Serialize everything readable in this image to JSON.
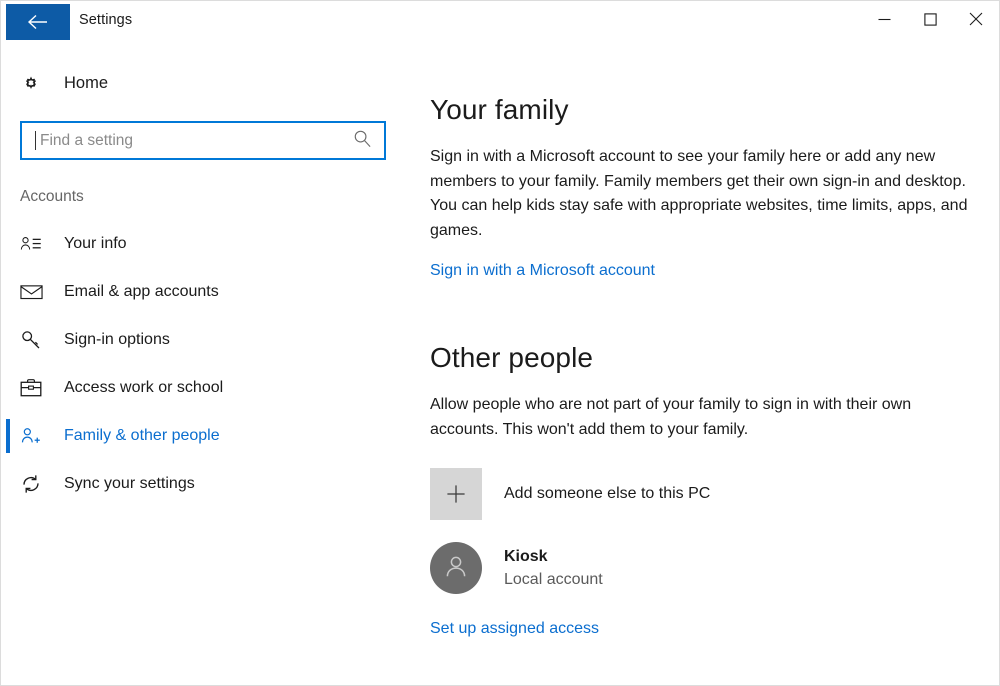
{
  "window": {
    "title": "Settings",
    "back_icon": "back-arrow-icon",
    "minimize_icon": "minimize-icon",
    "maximize_icon": "maximize-icon",
    "close_icon": "close-icon",
    "accent_color": "#0078d7",
    "link_color": "#0b6ecf",
    "titlebar_button_color": "#0d5ba6"
  },
  "sidebar": {
    "home": {
      "label": "Home",
      "icon": "gear-icon"
    },
    "search": {
      "placeholder": "Find a setting",
      "value": "",
      "icon": "search-icon",
      "focused": true
    },
    "section_label": "Accounts",
    "items": [
      {
        "label": "Your info",
        "icon": "person-info-icon",
        "selected": false
      },
      {
        "label": "Email & app accounts",
        "icon": "envelope-icon",
        "selected": false
      },
      {
        "label": "Sign-in options",
        "icon": "key-icon",
        "selected": false
      },
      {
        "label": "Access work or school",
        "icon": "briefcase-icon",
        "selected": false
      },
      {
        "label": "Family & other people",
        "icon": "person-add-icon",
        "selected": true
      },
      {
        "label": "Sync your settings",
        "icon": "sync-icon",
        "selected": false
      }
    ]
  },
  "main": {
    "family": {
      "heading": "Your family",
      "description": "Sign in with a Microsoft account to see your family here or add any new members to your family. Family members get their own sign-in and desktop. You can help kids stay safe with appropriate websites, time limits, apps, and games.",
      "link": "Sign in with a Microsoft account"
    },
    "other_people": {
      "heading": "Other people",
      "description": "Allow people who are not part of your family to sign in with their own accounts. This won't add them to your family.",
      "add_person": {
        "label": "Add someone else to this PC",
        "icon": "plus-icon"
      },
      "accounts": [
        {
          "name": "Kiosk",
          "type": "Local account",
          "avatar_icon": "person-avatar-icon"
        }
      ],
      "assigned_access_link": "Set up assigned access"
    }
  }
}
